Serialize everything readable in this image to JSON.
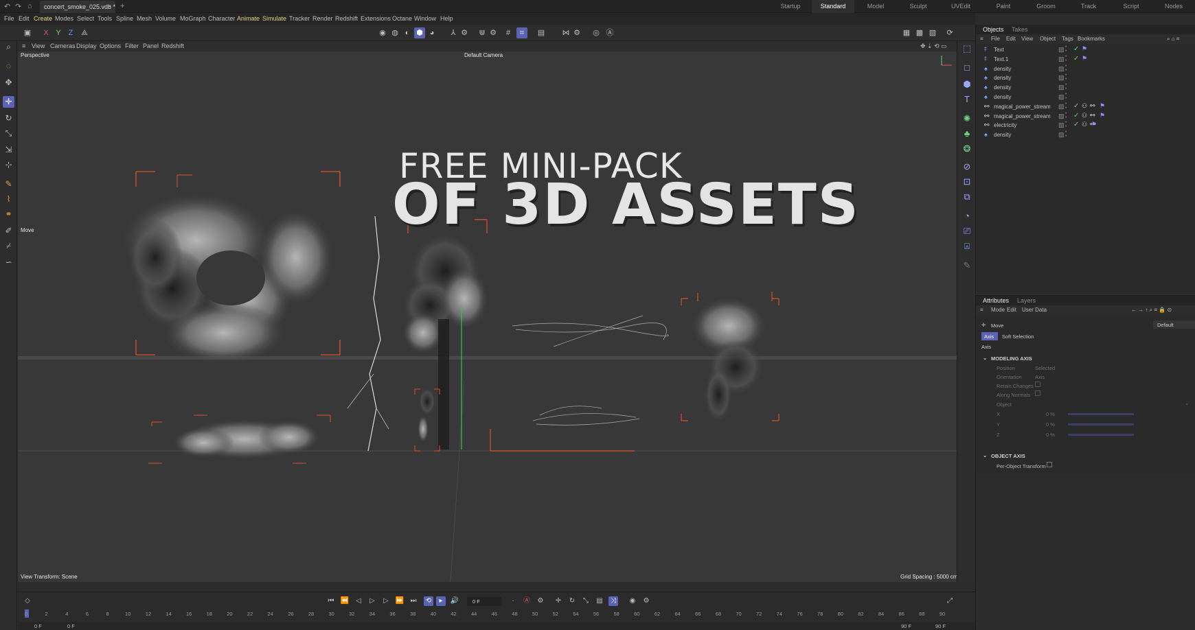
{
  "titlebar": {
    "doc_name": "concert_smoke_025.vdb *",
    "layouts": [
      "Startup",
      "Standard",
      "Model",
      "Sculpt",
      "UVEdit",
      "Paint",
      "Groom",
      "Track",
      "Script",
      "Nodes"
    ],
    "active_layout": "Standard"
  },
  "menubar": {
    "items": [
      "File",
      "Edit",
      "Create",
      "Modes",
      "Select",
      "Tools",
      "Spline",
      "Mesh",
      "Volume",
      "MoGraph",
      "Character",
      "Animate",
      "Simulate",
      "Tracker",
      "Render",
      "Redshift",
      "Extensions",
      "Octane",
      "Window",
      "Help"
    ]
  },
  "toolbar": {
    "axis_x": "X",
    "axis_y": "Y",
    "axis_z": "Z"
  },
  "viewport": {
    "menu": [
      "View",
      "Cameras",
      "Display",
      "Options",
      "Filter",
      "Panel",
      "Redshift"
    ],
    "mode_label": "Perspective",
    "camera_label": "Default Camera",
    "headline_line1": "FREE MINI-PACK",
    "headline_line2": "OF 3D ASSETS",
    "tool_label": "Move",
    "view_transform": "View Transform: Scene",
    "grid_spacing": "Grid Spacing : 5000 cm"
  },
  "objects_panel": {
    "tabs": [
      "Objects",
      "Takes"
    ],
    "menu": [
      "File",
      "Edit",
      "View",
      "Object",
      "Tags",
      "Bookmarks"
    ],
    "items": [
      {
        "name": "Text",
        "icon": "text-object-icon",
        "tags": "flag"
      },
      {
        "name": "Text.1",
        "icon": "text-object-icon",
        "tags": "flag"
      },
      {
        "name": "density",
        "icon": "volume-object-icon",
        "tags": ""
      },
      {
        "name": "density",
        "icon": "volume-object-icon",
        "tags": ""
      },
      {
        "name": "density",
        "icon": "volume-object-icon",
        "tags": ""
      },
      {
        "name": "density",
        "icon": "volume-object-icon",
        "tags": ""
      },
      {
        "name": "magical_power_stream",
        "icon": "emitter-object-icon",
        "tags": "full"
      },
      {
        "name": "magical_power_stream",
        "icon": "emitter-object-icon",
        "tags": "full"
      },
      {
        "name": "electricity",
        "icon": "emitter-object-icon",
        "tags": "partial"
      },
      {
        "name": "density",
        "icon": "volume-object-icon",
        "tags": ""
      }
    ]
  },
  "attributes_panel": {
    "tabs": [
      "Attributes",
      "Layers"
    ],
    "menu": [
      "Mode",
      "Edit",
      "User Data"
    ],
    "tool_name": "Move",
    "preset": "Default",
    "subtabs": [
      "Axis",
      "Soft Selection"
    ],
    "section_title": "Axis",
    "modeling_axis": "MODELING AXIS",
    "fields": [
      {
        "label": "Position",
        "value": "Selected"
      },
      {
        "label": "Orientation",
        "value": "Axis"
      },
      {
        "label": "Retain Changes",
        "value": ""
      },
      {
        "label": "Along Normals",
        "value": ""
      },
      {
        "label": "Object",
        "value": ""
      },
      {
        "label": "X",
        "value": "0 %"
      },
      {
        "label": "Y",
        "value": "0 %"
      },
      {
        "label": "Z",
        "value": "0 %"
      }
    ],
    "object_axis": "OBJECT AXIS",
    "per_object": "Per-Object Transform"
  },
  "timeline": {
    "current_frame": "0 F",
    "ticks": [
      "0",
      "2",
      "4",
      "6",
      "8",
      "10",
      "12",
      "14",
      "16",
      "18",
      "20",
      "22",
      "24",
      "26",
      "28",
      "30",
      "32",
      "34",
      "36",
      "38",
      "40",
      "42",
      "44",
      "46",
      "48",
      "50",
      "52",
      "54",
      "56",
      "58",
      "60",
      "62",
      "64",
      "66",
      "68",
      "70",
      "72",
      "74",
      "76",
      "78",
      "80",
      "82",
      "84",
      "86",
      "88",
      "90"
    ],
    "start_a": "0 F",
    "start_b": "0 F",
    "end_a": "90 F",
    "end_b": "90 F"
  }
}
